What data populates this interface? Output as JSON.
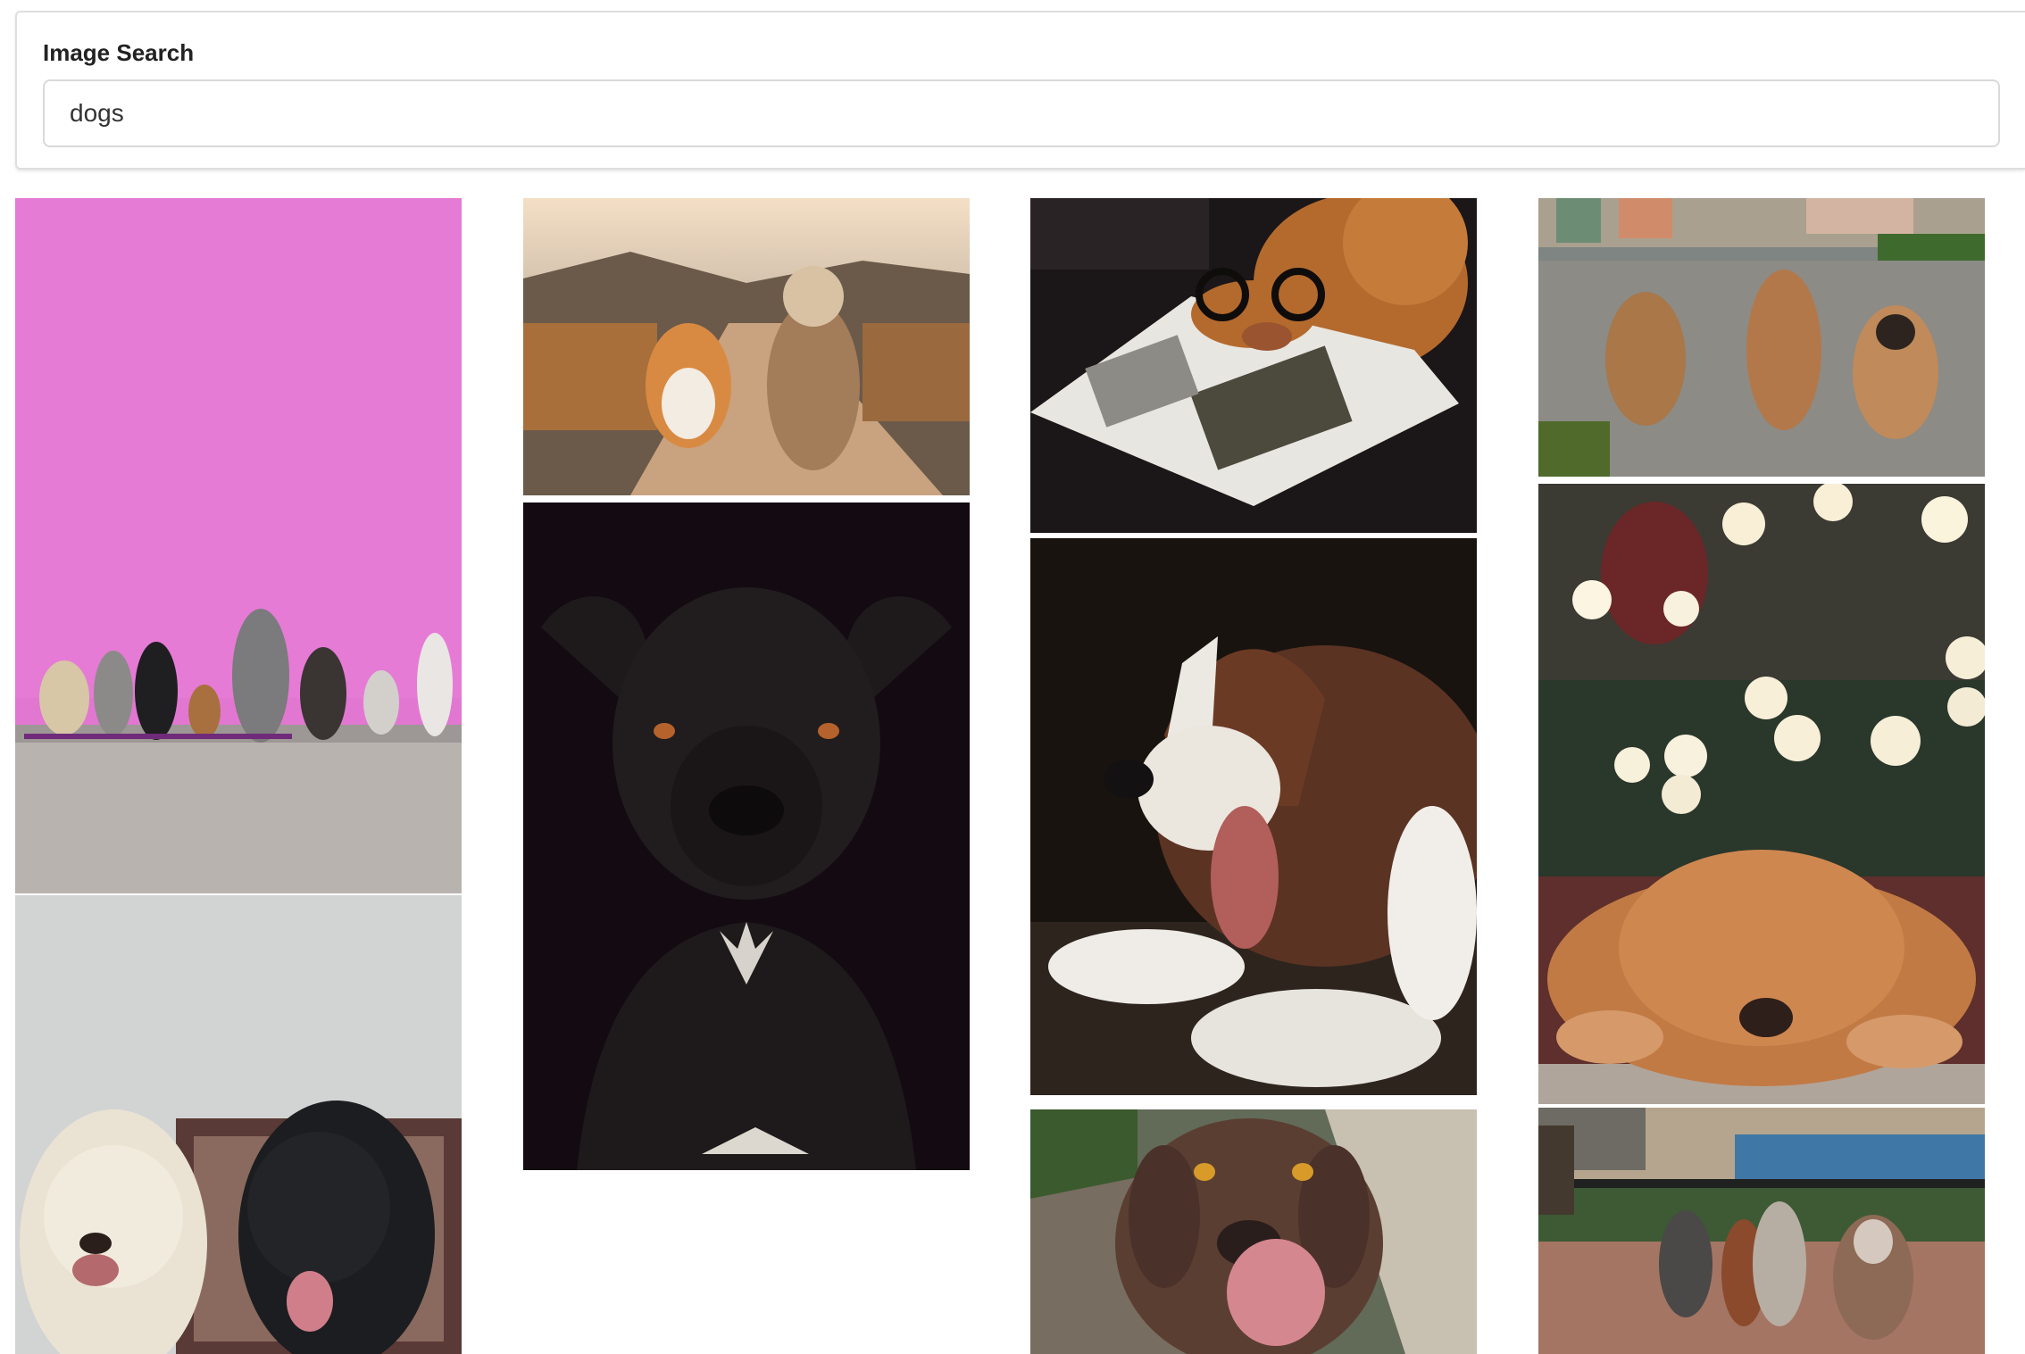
{
  "search": {
    "label": "Image Search",
    "value": "dogs",
    "placeholder": ""
  },
  "results": [
    {
      "id": "dogs-pink-wall",
      "palette": [
        "#e374d3",
        "#bfb8b4"
      ]
    },
    {
      "id": "corgi-yorkie-path",
      "palette": [
        "#c99c72",
        "#7f6a55"
      ]
    },
    {
      "id": "dog-glasses-magazine",
      "palette": [
        "#1b1618",
        "#b4692e"
      ]
    },
    {
      "id": "three-puppies-gravel",
      "palette": [
        "#8a8f8d",
        "#b07c52"
      ]
    },
    {
      "id": "black-dog-portrait",
      "palette": [
        "#140a12",
        "#26201f"
      ]
    },
    {
      "id": "yawning-puppy",
      "palette": [
        "#1a1412",
        "#6a3f2a"
      ]
    },
    {
      "id": "sleeping-golden-puppy",
      "palette": [
        "#2d3a2e",
        "#c27a45"
      ]
    },
    {
      "id": "doodle-and-lab",
      "palette": [
        "#d4d6d4",
        "#1a1a1c"
      ]
    },
    {
      "id": "licking-brown-dog",
      "palette": [
        "#5e6a55",
        "#5a3f33"
      ]
    },
    {
      "id": "dogs-on-leash-park",
      "palette": [
        "#5e7c4e",
        "#9a6f5a"
      ]
    }
  ]
}
